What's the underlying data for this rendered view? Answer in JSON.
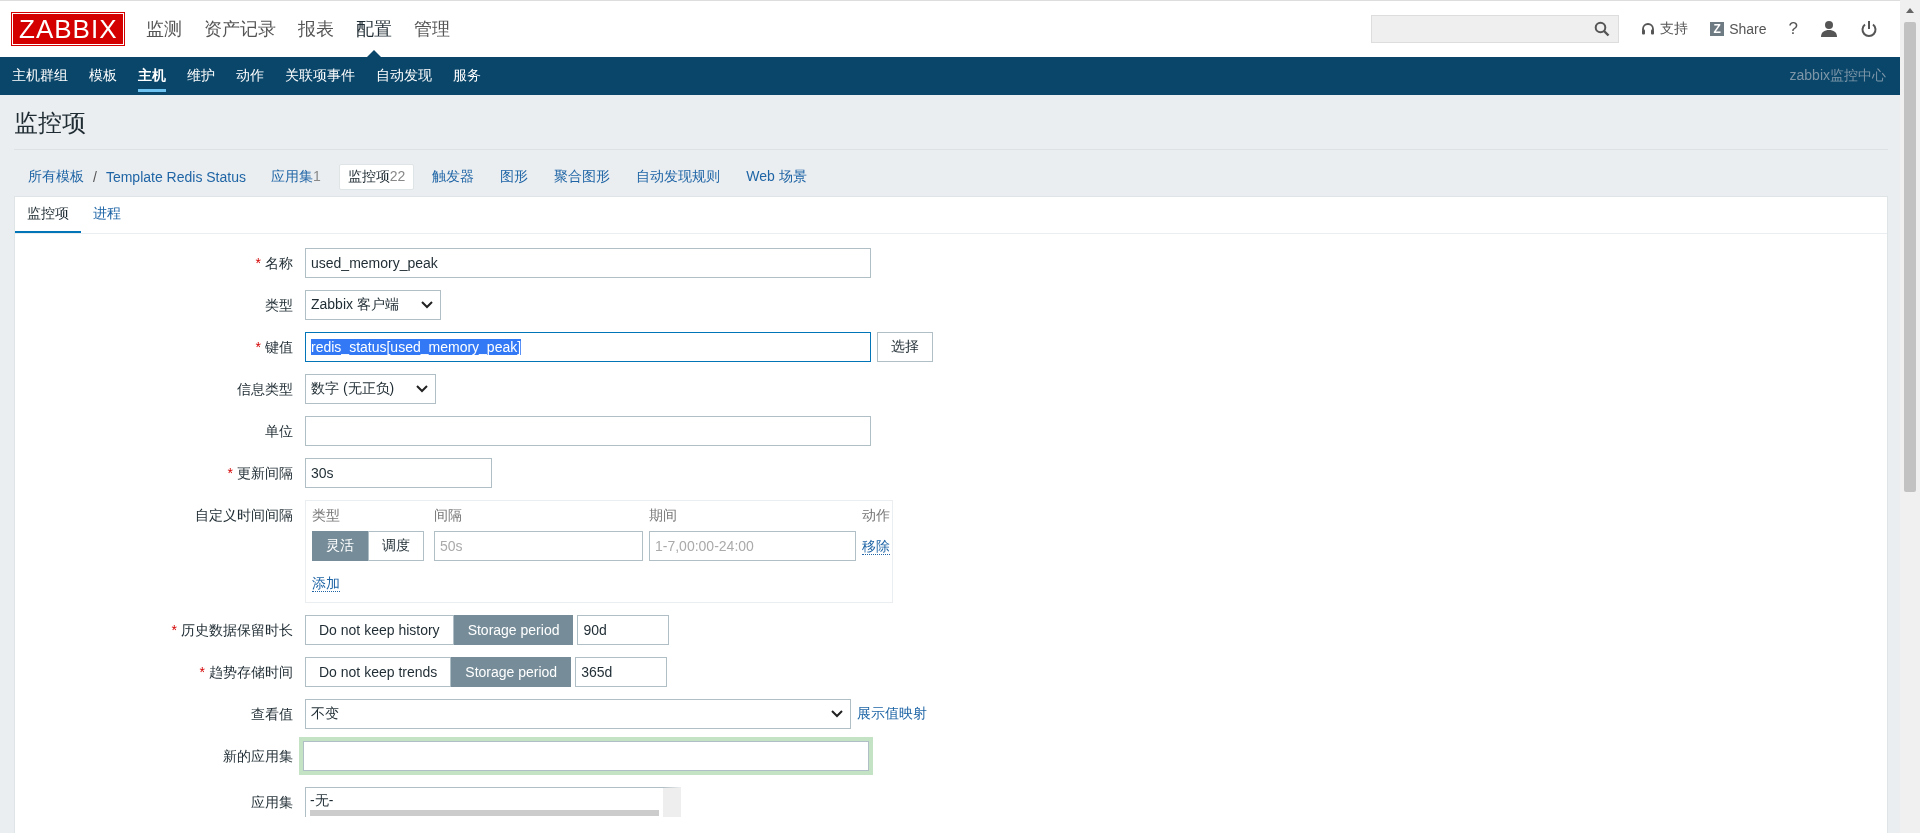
{
  "header": {
    "logo": "ZABBIX",
    "menu": [
      {
        "label": "监测",
        "selected": false
      },
      {
        "label": "资产记录",
        "selected": false
      },
      {
        "label": "报表",
        "selected": false
      },
      {
        "label": "配置",
        "selected": true
      },
      {
        "label": "管理",
        "selected": false
      }
    ],
    "support": "支持",
    "share_logo": "Z",
    "share": "Share",
    "help": "?"
  },
  "submenu": {
    "items": [
      {
        "label": "主机群组",
        "selected": false
      },
      {
        "label": "模板",
        "selected": false
      },
      {
        "label": "主机",
        "selected": true
      },
      {
        "label": "维护",
        "selected": false
      },
      {
        "label": "动作",
        "selected": false
      },
      {
        "label": "关联项事件",
        "selected": false
      },
      {
        "label": "自动发现",
        "selected": false
      },
      {
        "label": "服务",
        "selected": false
      }
    ],
    "server_name": "zabbix监控中心"
  },
  "page_title": "监控项",
  "breadcrumb": {
    "root": "所有模板",
    "separator": "/",
    "template": "Template Redis Status",
    "tabs": [
      {
        "label": "应用集",
        "count": "1",
        "selected": false
      },
      {
        "label": "监控项",
        "count": "22",
        "selected": true
      },
      {
        "label": "触发器",
        "selected": false
      },
      {
        "label": "图形",
        "selected": false
      },
      {
        "label": "聚合图形",
        "selected": false
      },
      {
        "label": "自动发现规则",
        "selected": false
      },
      {
        "label": "Web 场景",
        "selected": false
      }
    ]
  },
  "form_tabs": [
    {
      "label": "监控项",
      "selected": true
    },
    {
      "label": "进程",
      "selected": false
    }
  ],
  "fields": [
    {
      "kind": "text",
      "label": "名称",
      "required_mark": "*",
      "value": "used_memory_peak"
    },
    {
      "kind": "select",
      "label": "类型",
      "value": "Zabbix 客户端"
    },
    {
      "kind": "key",
      "label": "键值",
      "required_mark": "*",
      "value": "redis_status[used_memory_peak]",
      "button": "选择"
    },
    {
      "kind": "select",
      "label": "信息类型",
      "value": "数字 (无正负)"
    },
    {
      "kind": "text",
      "label": "单位"
    },
    {
      "kind": "short_text",
      "label": "更新间隔",
      "required_mark": "*",
      "value": "30s"
    },
    {
      "kind": "intervals",
      "label": "自定义时间间隔",
      "columns": [
        "类型",
        "间隔",
        "期间",
        "动作"
      ],
      "rows": [
        {
          "modes": [
            {
              "label": "灵活",
              "selected": true
            },
            {
              "label": "调度",
              "selected": false
            }
          ],
          "interval_placeholder": "50s",
          "period_placeholder": "1-7,00:00-24:00",
          "remove": "移除"
        }
      ],
      "add": "添加"
    },
    {
      "kind": "storage",
      "label": "历史数据保留时长",
      "required_mark": "*",
      "options": [
        {
          "label": "Do not keep history",
          "selected": false
        },
        {
          "label": "Storage period",
          "selected": true
        }
      ],
      "value": "90d"
    },
    {
      "kind": "storage",
      "label": "趋势存储时间",
      "required_mark": "*",
      "options": [
        {
          "label": "Do not keep trends",
          "selected": false
        },
        {
          "label": "Storage period",
          "selected": true
        }
      ],
      "value": "365d"
    },
    {
      "kind": "select_link",
      "label": "查看值",
      "value": "不变",
      "link": "展示值映射"
    },
    {
      "kind": "focused_text",
      "label": "新的应用集"
    },
    {
      "kind": "listbox",
      "label": "应用集",
      "items": [
        "-无-"
      ]
    }
  ]
}
